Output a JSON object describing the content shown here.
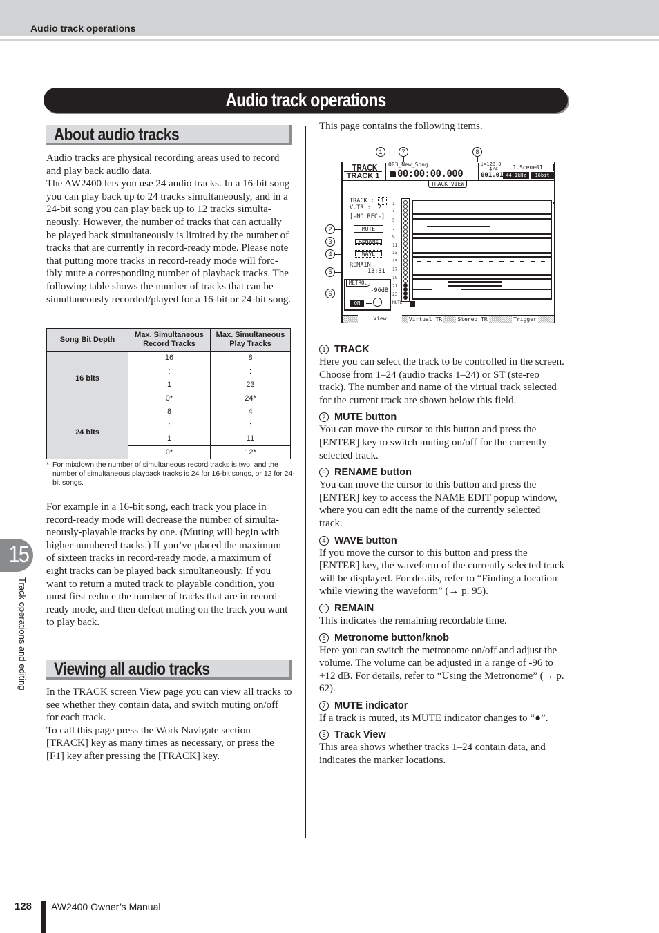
{
  "header": {
    "title": "Audio track operations"
  },
  "page_title": "Audio track operations",
  "sections": {
    "about": {
      "heading": "About audio tracks",
      "paragraphs": [
        "Audio tracks are physical recording areas used to record and play back audio data.",
        "The AW2400 lets you use 24 audio tracks. In a 16-bit song you can play back up to 24 tracks simultaneously, and in a 24-bit song you can play back up to 12 tracks simulta-neously. However, the number of tracks that can actually be played back simultaneously is limited by the number of tracks that are currently in record-ready mode. Please note that putting more tracks in record-ready mode will forc-ibly mute a corresponding number of playback tracks. The following table shows the number of tracks that can be simultaneously recorded/played for a 16-bit or 24-bit song."
      ],
      "table": {
        "headers": [
          "Song Bit Depth",
          "Max. Simultaneous Record Tracks",
          "Max. Simultaneous Play Tracks"
        ],
        "groups": [
          {
            "label": "16 bits",
            "rows": [
              [
                "16",
                "8"
              ],
              [
                ":",
                ":"
              ],
              [
                "1",
                "23"
              ],
              [
                "0*",
                "24*"
              ]
            ]
          },
          {
            "label": "24 bits",
            "rows": [
              [
                "8",
                "4"
              ],
              [
                ":",
                ":"
              ],
              [
                "1",
                "11"
              ],
              [
                "0*",
                "12*"
              ]
            ]
          }
        ],
        "footnote_mark": "*",
        "footnote": "For mixdown the number of simultaneous record tracks is two, and the number of simultaneous playback tracks is 24 for 16-bit songs, or 12 for 24-bit songs."
      },
      "example_paragraph": "For example in a 16-bit song, each track you place in record-ready mode will decrease the number of simulta-neously-playable tracks by one. (Muting will begin with higher-numbered tracks.) If you’ve placed the maximum of sixteen tracks in record-ready mode, a maximum of eight tracks can be played back simultaneously. If you want to return a muted track to playable condition, you must first reduce the number of tracks that are in record-ready mode, and then defeat muting on the track you want to play back."
    },
    "viewing": {
      "heading": "Viewing all audio tracks",
      "paragraphs": [
        "In the TRACK screen View page you can view all tracks to see whether they contain data, and switch muting on/off for each track.",
        "To call this page press the Work Navigate section [TRACK] key as many times as necessary, or press the [F1] key after pressing the [TRACK] key."
      ]
    }
  },
  "right_column": {
    "intro": "This page contains the following items.",
    "items": [
      {
        "num": "1",
        "title": "TRACK",
        "text": "Here you can select the track to be controlled in the screen. Choose from 1–24 (audio tracks 1–24) or ST (ste-reo track). The number and name of the virtual track selected for the current track are shown below this field."
      },
      {
        "num": "2",
        "title": "MUTE button",
        "text": "You can move the cursor to this button and press the [ENTER] key to switch muting on/off for the currently selected track."
      },
      {
        "num": "3",
        "title": "RENAME button",
        "text": "You can move the cursor to this button and press the [ENTER] key to access the NAME EDIT popup window, where you can edit the name of the currently selected track."
      },
      {
        "num": "4",
        "title": "WAVE button",
        "text": "If you move the cursor to this button and press the [ENTER] key, the waveform of the currently selected track will be displayed. For details, refer to “Finding a location while viewing the waveform” (→ p. 95)."
      },
      {
        "num": "5",
        "title": "REMAIN",
        "text": "This indicates the remaining recordable time."
      },
      {
        "num": "6",
        "title": "Metronome button/knob",
        "text": "Here you can switch the metronome on/off and adjust the volume. The volume can be adjusted in a range of -96 to +12 dB. For details, refer to “Using the Metronome” (→ p. 62)."
      },
      {
        "num": "7",
        "title": "MUTE indicator",
        "text": "If a track is muted, its MUTE indicator changes to “●”."
      },
      {
        "num": "8",
        "title": "Track View",
        "text": "This area shows whether tracks 1–24 contain data, and indicates the marker locations."
      }
    ]
  },
  "lcd": {
    "screen_title": "TRACK",
    "screen_subtitle": "TRACK 1",
    "song_name": "003_New_Song",
    "time": "00:00:00.000",
    "tempo": "♩=120.0",
    "signature": "4/4",
    "bar_beat": "001.01",
    "scene": "1.Scene01",
    "sample_rate": "44.1kHz",
    "bit_depth": "16bit",
    "page_label": "TRACK VIEW",
    "track_label": "TRACK :",
    "track_value": "1",
    "vtr_label": "V.TR :",
    "vtr_value": "2",
    "rec_status": "[-NO REC-]",
    "mute_button": "MUTE",
    "rename_button": "RENAME",
    "wave_button": "WAVE",
    "remain_label": "REMAIN",
    "remain_value": "13:31",
    "metro_label": "METRO.",
    "metro_level": "-96dB",
    "metro_on": "ON",
    "track_numbers": [
      "1",
      "3",
      "5",
      "7",
      "9",
      "11",
      "13",
      "15",
      "17",
      "19",
      "21",
      "23",
      "MUTE"
    ],
    "muted_tracks": [
      21,
      22,
      23,
      24
    ],
    "marker_badge": "1",
    "tabs": [
      "View",
      "Virtual TR",
      "Stereo TR",
      "Trigger"
    ],
    "active_tab": "View",
    "callouts": [
      "1",
      "7",
      "8",
      "2",
      "3",
      "4",
      "5",
      "6"
    ]
  },
  "chapter": {
    "number": "15",
    "label": "Track operations and editing"
  },
  "footer": {
    "page_number": "128",
    "manual": "AW2400  Owner’s Manual"
  }
}
